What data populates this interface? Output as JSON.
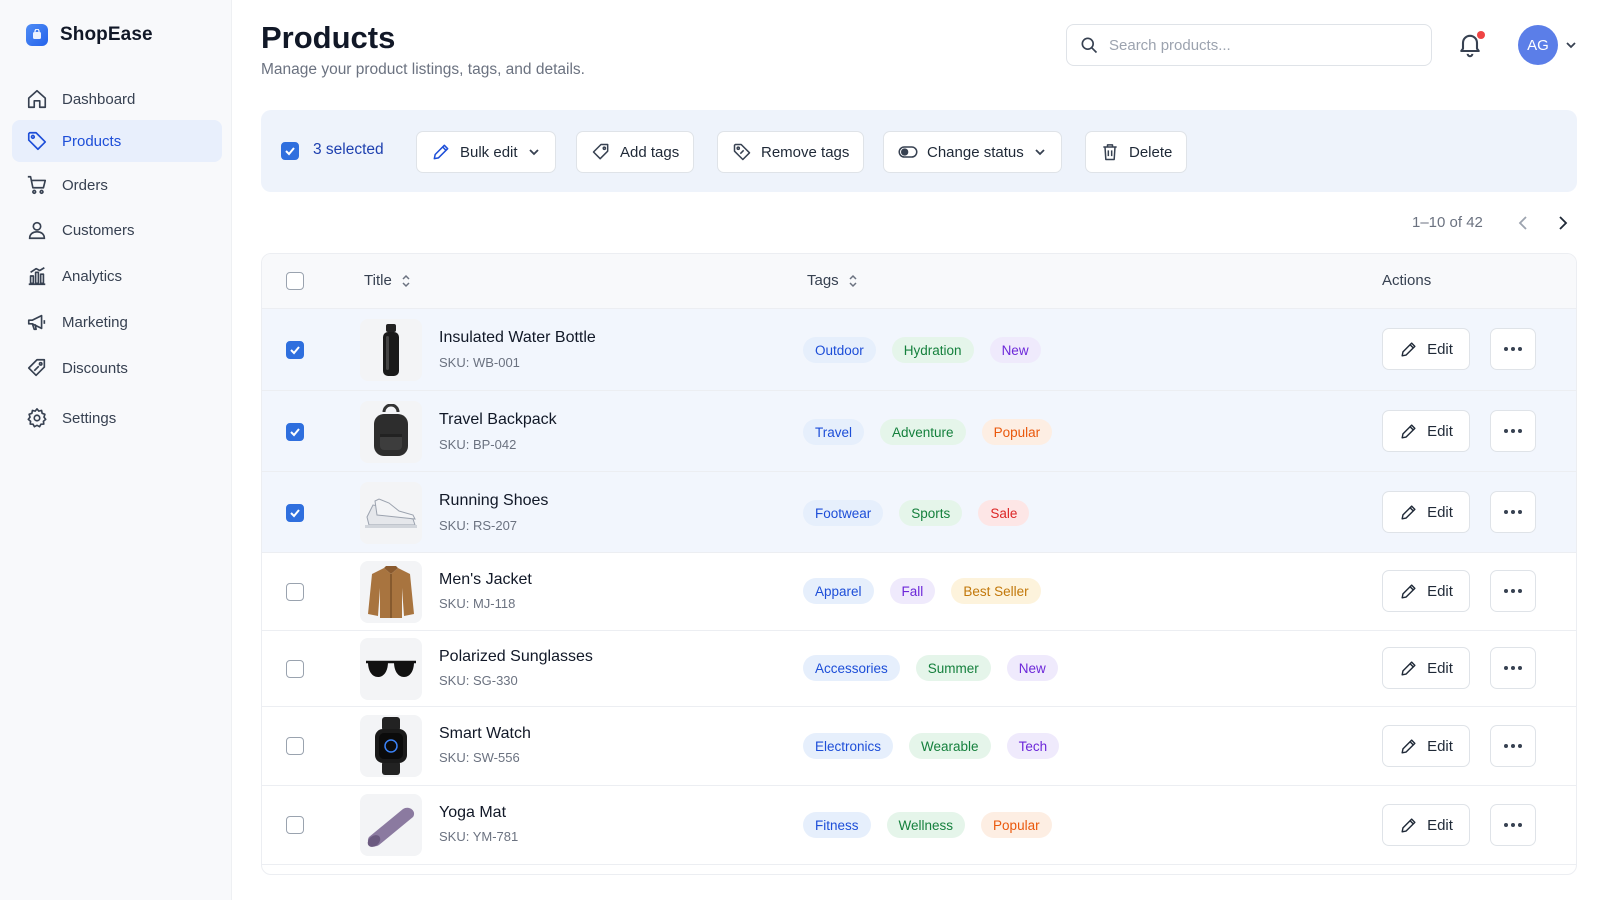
{
  "brand": {
    "name": "ShopEase"
  },
  "sidebar": {
    "items": [
      {
        "label": "Dashboard",
        "icon": "home-icon"
      },
      {
        "label": "Products",
        "icon": "tag-icon",
        "active": true
      },
      {
        "label": "Orders",
        "icon": "cart-icon"
      },
      {
        "label": "Customers",
        "icon": "user-icon"
      },
      {
        "label": "Analytics",
        "icon": "chart-icon"
      },
      {
        "label": "Marketing",
        "icon": "megaphone-icon"
      },
      {
        "label": "Discounts",
        "icon": "discount-icon"
      },
      {
        "label": "Settings",
        "icon": "gear-icon"
      }
    ]
  },
  "header": {
    "title": "Products",
    "subtitle": "Manage your product listings, tags, and details.",
    "search_placeholder": "Search products...",
    "avatar_initials": "AG"
  },
  "bulk": {
    "selected_label": "3 selected",
    "bulk_edit": "Bulk edit",
    "add_tags": "Add tags",
    "remove_tags": "Remove tags",
    "change_status": "Change status",
    "delete": "Delete"
  },
  "pagination": {
    "label": "1–10 of 42"
  },
  "table": {
    "columns": {
      "title": "Title",
      "tags": "Tags",
      "actions": "Actions"
    },
    "edit_label": "Edit",
    "rows": [
      {
        "name": "Insulated Water Bottle",
        "sku": "SKU: WB-001",
        "selected": true,
        "tags": [
          {
            "text": "Outdoor",
            "color": "blue"
          },
          {
            "text": "Hydration",
            "color": "green"
          },
          {
            "text": "New",
            "color": "purple"
          }
        ]
      },
      {
        "name": "Travel Backpack",
        "sku": "SKU: BP-042",
        "selected": true,
        "tags": [
          {
            "text": "Travel",
            "color": "blue"
          },
          {
            "text": "Adventure",
            "color": "green"
          },
          {
            "text": "Popular",
            "color": "orange"
          }
        ]
      },
      {
        "name": "Running Shoes",
        "sku": "SKU: RS-207",
        "selected": true,
        "tags": [
          {
            "text": "Footwear",
            "color": "blue"
          },
          {
            "text": "Sports",
            "color": "green"
          },
          {
            "text": "Sale",
            "color": "red"
          }
        ]
      },
      {
        "name": "Men's Jacket",
        "sku": "SKU: MJ-118",
        "selected": false,
        "tags": [
          {
            "text": "Apparel",
            "color": "blue"
          },
          {
            "text": "Fall",
            "color": "purple"
          },
          {
            "text": "Best Seller",
            "color": "amber"
          }
        ]
      },
      {
        "name": "Polarized Sunglasses",
        "sku": "SKU: SG-330",
        "selected": false,
        "tags": [
          {
            "text": "Accessories",
            "color": "blue"
          },
          {
            "text": "Summer",
            "color": "green"
          },
          {
            "text": "New",
            "color": "purple"
          }
        ]
      },
      {
        "name": "Smart Watch",
        "sku": "SKU: SW-556",
        "selected": false,
        "tags": [
          {
            "text": "Electronics",
            "color": "blue"
          },
          {
            "text": "Wearable",
            "color": "green"
          },
          {
            "text": "Tech",
            "color": "purple"
          }
        ]
      },
      {
        "name": "Yoga Mat",
        "sku": "SKU: YM-781",
        "selected": false,
        "tags": [
          {
            "text": "Fitness",
            "color": "blue"
          },
          {
            "text": "Wellness",
            "color": "green"
          },
          {
            "text": "Popular",
            "color": "orange"
          }
        ]
      }
    ]
  },
  "colors": {
    "accent": "#2f6fde",
    "active_nav_bg": "#e8effc",
    "notification": "#ef4444"
  }
}
